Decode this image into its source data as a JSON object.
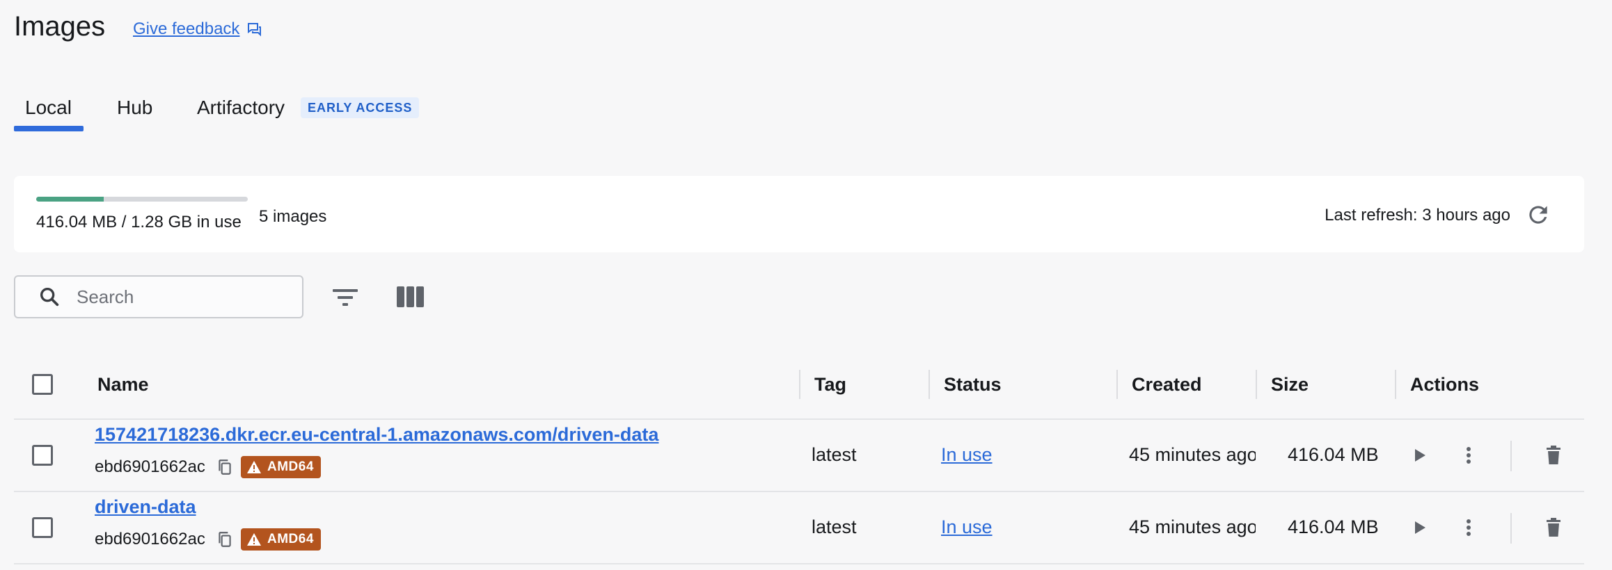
{
  "header": {
    "title": "Images",
    "feedback_label": "Give feedback"
  },
  "tabs": [
    {
      "label": "Local",
      "active": true
    },
    {
      "label": "Hub",
      "active": false
    },
    {
      "label": "Artifactory",
      "active": false,
      "badge": "EARLY ACCESS"
    }
  ],
  "usage": {
    "text": "416.04 MB / 1.28 GB in use",
    "fraction_used": 0.318,
    "images_count": "5 images",
    "last_refresh": "Last refresh: 3 hours ago"
  },
  "search": {
    "placeholder": "Search",
    "value": ""
  },
  "table": {
    "columns": [
      "Name",
      "Tag",
      "Status",
      "Created",
      "Size",
      "Actions"
    ],
    "rows": [
      {
        "name": "157421718236.dkr.ecr.eu-central-1.amazonaws.com/driven-data",
        "image_id": "ebd6901662ac",
        "arch": "AMD64",
        "tag": "latest",
        "status": "In use",
        "created": "45 minutes ago",
        "size": "416.04 MB"
      },
      {
        "name": "driven-data",
        "image_id": "ebd6901662ac",
        "arch": "AMD64",
        "tag": "latest",
        "status": "In use",
        "created": "45 minutes ago",
        "size": "416.04 MB"
      }
    ]
  },
  "colors": {
    "accent": "#2f6bdb",
    "link": "#2b6ad8",
    "usage_fill": "#4aa283",
    "arch_badge": "#b3541e",
    "early_access_bg": "#e5eefc"
  },
  "icons": {
    "feedback": "chat-bubbles-icon",
    "refresh": "refresh-icon",
    "search": "search-icon",
    "filter": "filter-icon",
    "columns": "columns-icon",
    "copy": "copy-icon",
    "warning": "warning-icon",
    "run": "play-icon",
    "more": "more-vert-icon",
    "delete": "trash-icon"
  }
}
